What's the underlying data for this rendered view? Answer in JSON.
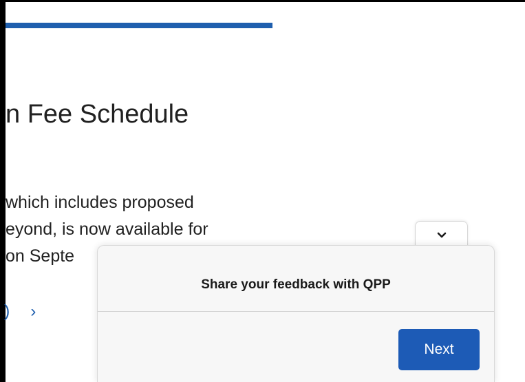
{
  "article": {
    "title": "n Fee Schedule",
    "lines": [
      " which includes proposed",
      "eyond, is now available for",
      "on Septe"
    ],
    "link_text": ")",
    "link_chevron": "›"
  },
  "feedback_widget": {
    "title": "Share your feedback with QPP",
    "next_label": "Next",
    "collapse_icon": "chevron-down-icon"
  },
  "colors": {
    "accent": "#1f5fae",
    "button": "#1d5bb6",
    "panel": "#f7f7f7"
  }
}
